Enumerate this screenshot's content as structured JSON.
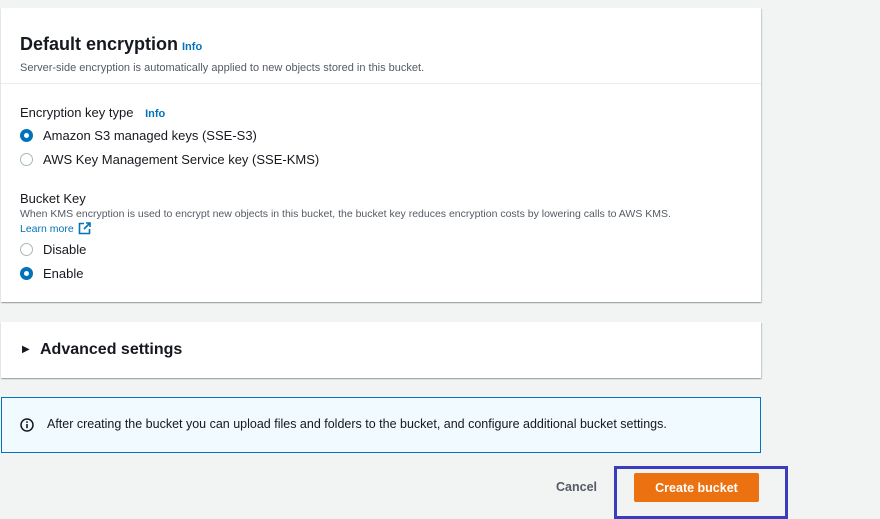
{
  "encryption": {
    "title": "Default encryption",
    "info_label": "Info",
    "description": "Server-side encryption is automatically applied to new objects stored in this bucket.",
    "key_type_label": "Encryption key type",
    "key_type_info": "Info",
    "options": [
      {
        "label": "Amazon S3 managed keys (SSE-S3)",
        "selected": true
      },
      {
        "label": "AWS Key Management Service key (SSE-KMS)",
        "selected": false
      }
    ],
    "bucket_key": {
      "label": "Bucket Key",
      "description": "When KMS encryption is used to encrypt new objects in this bucket, the bucket key reduces encryption costs by lowering calls to AWS KMS.",
      "learn_more": "Learn more",
      "options": [
        {
          "label": "Disable",
          "selected": false
        },
        {
          "label": "Enable",
          "selected": true
        }
      ]
    }
  },
  "advanced": {
    "title": "Advanced settings",
    "caret": "▶"
  },
  "alert": {
    "text": "After creating the bucket you can upload files and folders to the bucket, and configure additional bucket settings."
  },
  "actions": {
    "cancel": "Cancel",
    "create": "Create bucket"
  },
  "colors": {
    "accent": "#0073bb",
    "primary_button": "#ec7211",
    "highlight_box": "#3b3dbf"
  }
}
